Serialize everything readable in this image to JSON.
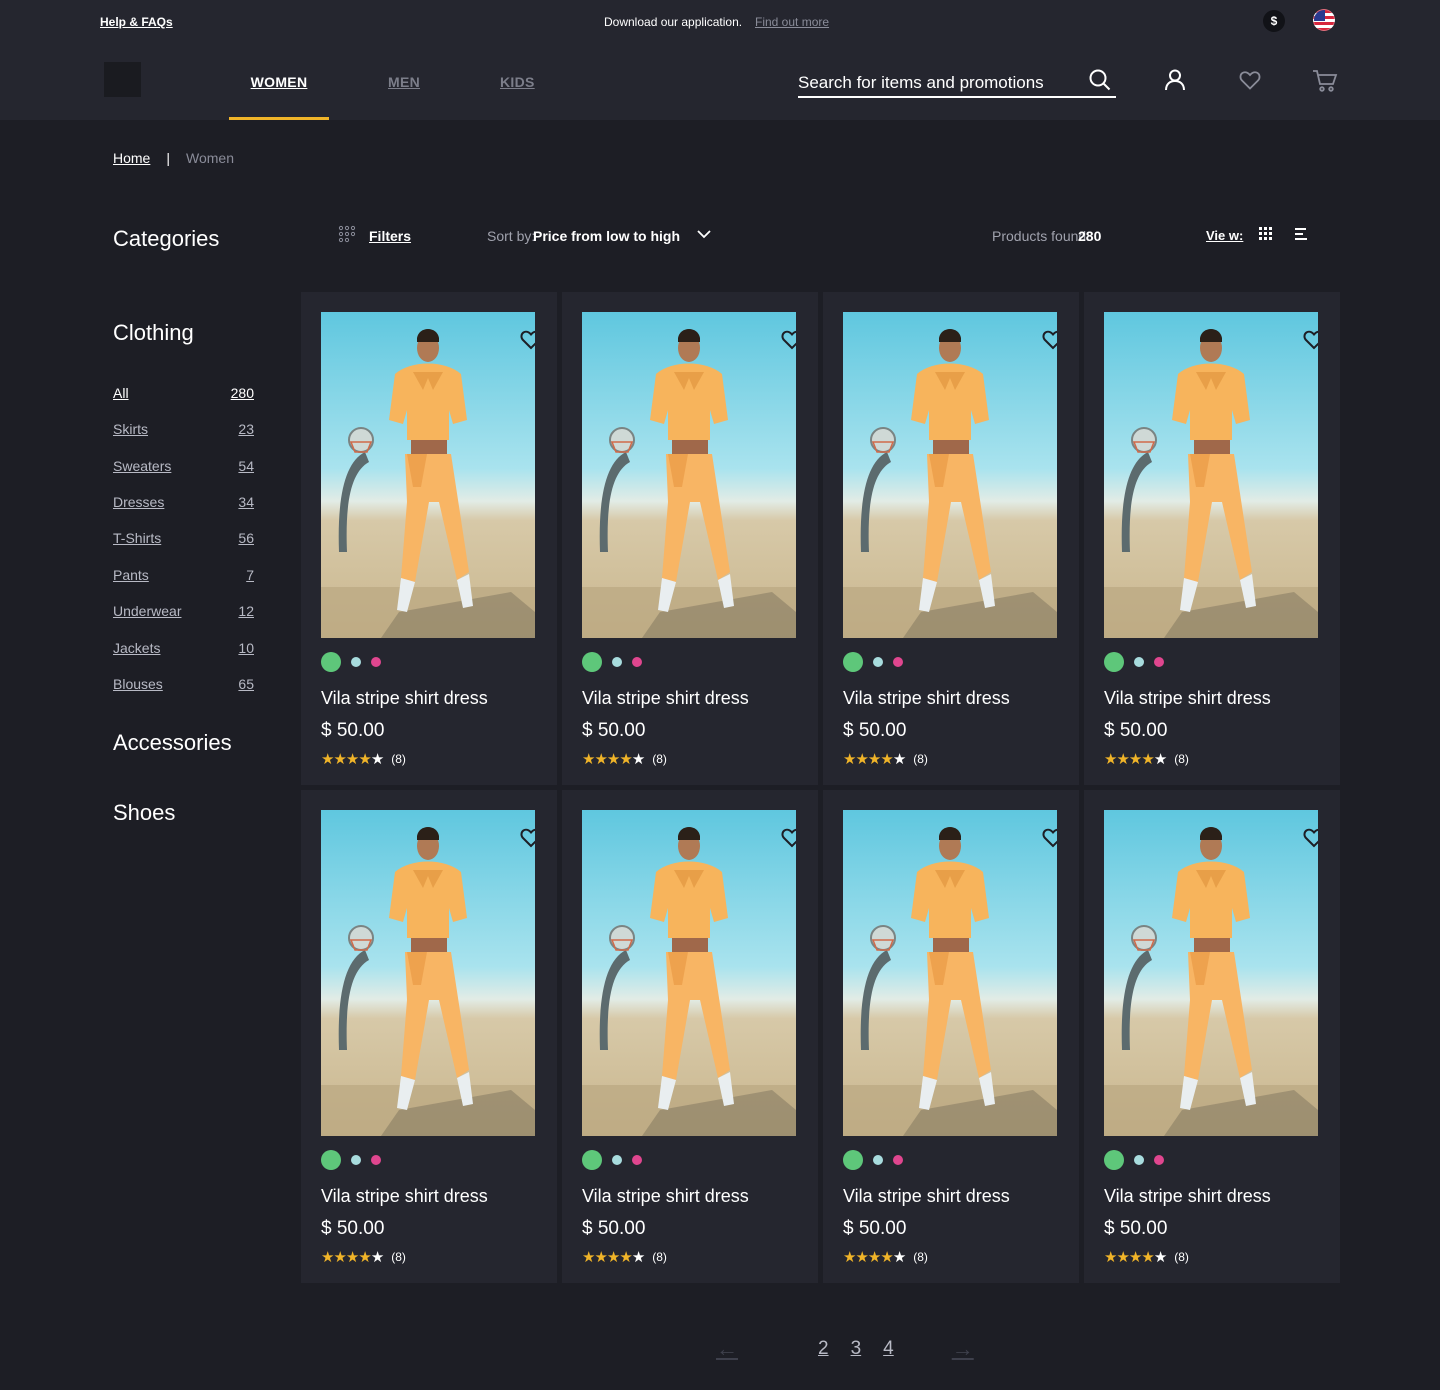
{
  "topbar": {
    "help": "Help & FAQs",
    "download": "Download our application.",
    "find_out": "Find out more",
    "currency": "$"
  },
  "nav": {
    "tabs": [
      {
        "label": "WOMEN",
        "active": true
      },
      {
        "label": "MEN",
        "active": false
      },
      {
        "label": "KIDS",
        "active": false
      }
    ],
    "accent_color": "#f0b429"
  },
  "search": {
    "placeholder": "Search for items and promotions"
  },
  "breadcrumb": {
    "home": "Home",
    "separator": "|",
    "current": "Women"
  },
  "sidebar": {
    "categories_title": "Categories",
    "clothing_title": "Clothing",
    "items": [
      {
        "label": "All",
        "count": "280",
        "active": true
      },
      {
        "label": "Skirts",
        "count": "23"
      },
      {
        "label": "Sweaters",
        "count": "54"
      },
      {
        "label": "Dresses",
        "count": "34"
      },
      {
        "label": "T-Shirts",
        "count": "56"
      },
      {
        "label": "Pants",
        "count": "7"
      },
      {
        "label": "Underwear",
        "count": "12"
      },
      {
        "label": "Jackets",
        "count": "10"
      },
      {
        "label": "Blouses",
        "count": "65"
      }
    ],
    "accessories_title": "Accessories",
    "shoes_title": "Shoes"
  },
  "toolbar": {
    "filters": "Filters",
    "sort_label": "Sort by:",
    "sort_value": "Price from low to high",
    "found_label": "Products found:",
    "found_count": "280",
    "view_label": "Vie w:"
  },
  "products": [
    {
      "name": "Vila stripe shirt dress",
      "price": "$ 50.00",
      "rating": 4,
      "reviews": "(8)",
      "swatches": [
        "#5ec77a",
        "#a8dcde",
        "#e0468f"
      ]
    },
    {
      "name": "Vila stripe shirt dress",
      "price": "$ 50.00",
      "rating": 4,
      "reviews": "(8)",
      "swatches": [
        "#5ec77a",
        "#a8dcde",
        "#e0468f"
      ]
    },
    {
      "name": "Vila stripe shirt dress",
      "price": "$ 50.00",
      "rating": 4,
      "reviews": "(8)",
      "swatches": [
        "#5ec77a",
        "#a8dcde",
        "#e0468f"
      ]
    },
    {
      "name": "Vila stripe shirt dress",
      "price": "$ 50.00",
      "rating": 4,
      "reviews": "(8)",
      "swatches": [
        "#5ec77a",
        "#a8dcde",
        "#e0468f"
      ]
    },
    {
      "name": "Vila stripe shirt dress",
      "price": "$ 50.00",
      "rating": 4,
      "reviews": "(8)",
      "swatches": [
        "#5ec77a",
        "#a8dcde",
        "#e0468f"
      ]
    },
    {
      "name": "Vila stripe shirt dress",
      "price": "$ 50.00",
      "rating": 4,
      "reviews": "(8)",
      "swatches": [
        "#5ec77a",
        "#a8dcde",
        "#e0468f"
      ]
    },
    {
      "name": "Vila stripe shirt dress",
      "price": "$ 50.00",
      "rating": 4,
      "reviews": "(8)",
      "swatches": [
        "#5ec77a",
        "#a8dcde",
        "#e0468f"
      ]
    },
    {
      "name": "Vila stripe shirt dress",
      "price": "$ 50.00",
      "rating": 4,
      "reviews": "(8)",
      "swatches": [
        "#5ec77a",
        "#a8dcde",
        "#e0468f"
      ]
    }
  ],
  "pagination": {
    "prev": "←",
    "pages": [
      "2",
      "3",
      "4"
    ],
    "next": "→"
  },
  "icons": {
    "header": [
      "search-icon",
      "user-icon",
      "heart-icon",
      "cart-icon"
    ],
    "card": "heart-icon"
  }
}
